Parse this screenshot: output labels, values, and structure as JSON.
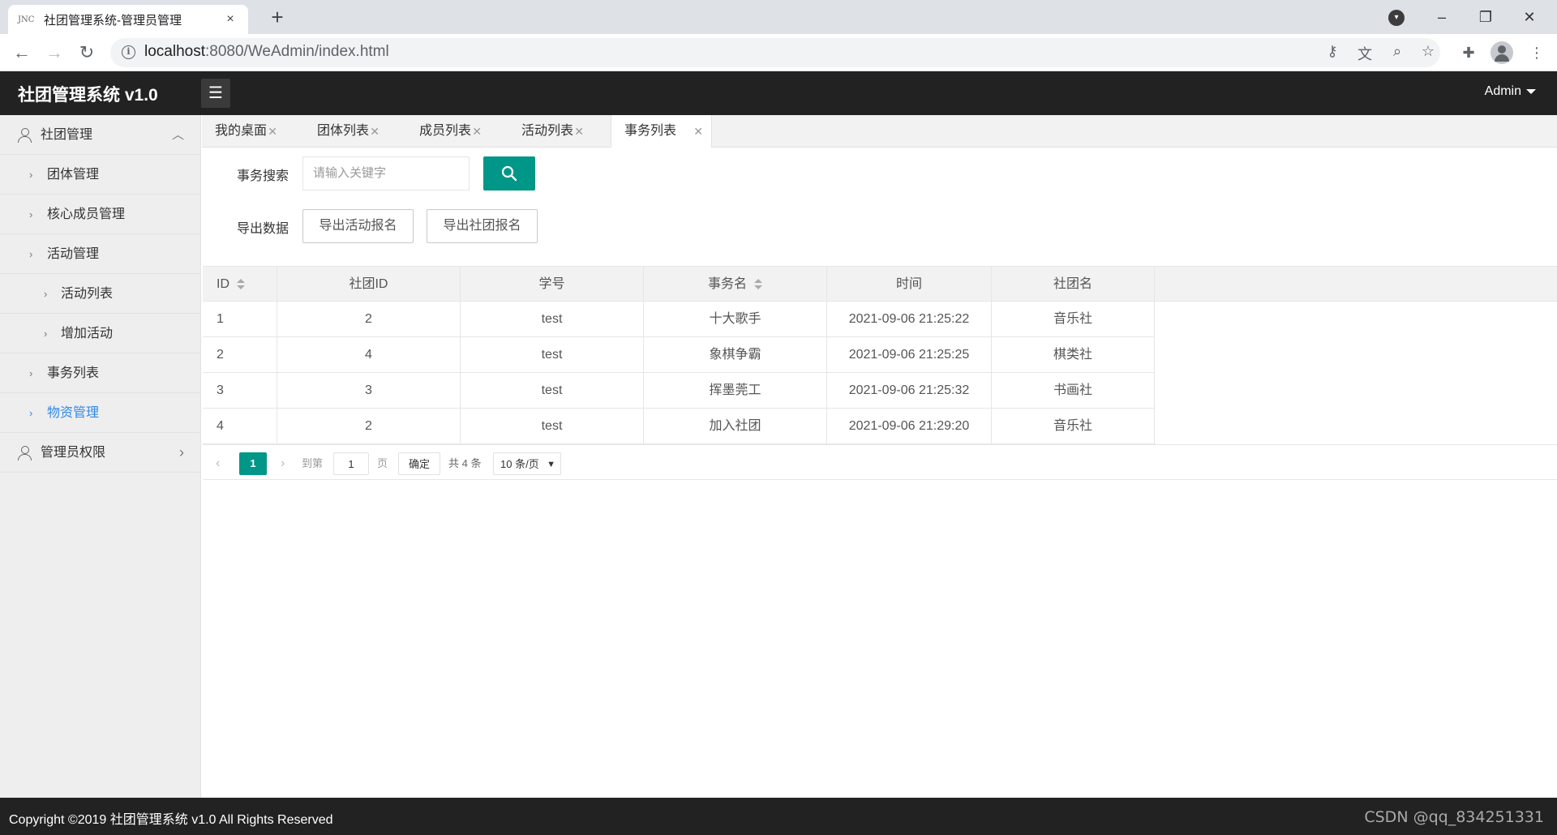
{
  "browser": {
    "favicon_text": "JNC",
    "tab_title": "社团管理系统-管理员管理",
    "tab_close": "×",
    "new_tab": "+",
    "url_host": "localhost",
    "url_rest": ":8080/WeAdmin/index.html"
  },
  "header": {
    "app_title": "社团管理系统 v1.0",
    "menu_toggle": "☰",
    "user": "Admin"
  },
  "sidebar": {
    "groups": [
      {
        "label": "社团管理",
        "expanded": true
      },
      {
        "label": "管理员权限",
        "expanded": false
      }
    ],
    "items": [
      {
        "label": "团体管理"
      },
      {
        "label": "核心成员管理"
      },
      {
        "label": "活动管理"
      },
      {
        "label": "活动列表"
      },
      {
        "label": "增加活动"
      },
      {
        "label": "事务列表"
      },
      {
        "label": "物资管理",
        "active": true
      }
    ]
  },
  "main_tabs": [
    {
      "label": "我的桌面"
    },
    {
      "label": "团体列表"
    },
    {
      "label": "成员列表"
    },
    {
      "label": "活动列表"
    },
    {
      "label": "事务列表",
      "active": true
    }
  ],
  "search": {
    "label": "事务搜索",
    "placeholder": "请输入关键字"
  },
  "export": {
    "label": "导出数据",
    "btn_activity": "导出活动报名",
    "btn_club": "导出社团报名"
  },
  "table": {
    "columns": [
      "ID",
      "社团ID",
      "学号",
      "事务名",
      "时间",
      "社团名"
    ],
    "rows": [
      [
        "1",
        "2",
        "test",
        "十大歌手",
        "2021-09-06 21:25:22",
        "音乐社"
      ],
      [
        "2",
        "4",
        "test",
        "象棋争霸",
        "2021-09-06 21:25:25",
        "棋类社"
      ],
      [
        "3",
        "3",
        "test",
        "挥墨莞工",
        "2021-09-06 21:25:32",
        "书画社"
      ],
      [
        "4",
        "2",
        "test",
        "加入社团",
        "2021-09-06 21:29:20",
        "音乐社"
      ]
    ]
  },
  "pager": {
    "current": "1",
    "goto_prefix": "到第",
    "goto_value": "1",
    "goto_suffix": "页",
    "confirm": "确定",
    "total": "共 4 条",
    "page_size": "10 条/页"
  },
  "footer": {
    "copyright": "Copyright ©2019 社团管理系统 v1.0 All Rights Reserved",
    "watermark": "CSDN @qq_834251331"
  },
  "colors": {
    "primary": "#009688",
    "active_link": "#2f8ae5",
    "header_bg": "#222222"
  }
}
